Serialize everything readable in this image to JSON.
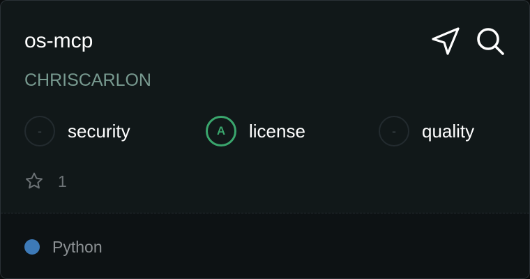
{
  "repo": {
    "name": "os-mcp",
    "owner": "CHRISCARLON"
  },
  "actions": {
    "send_icon": "send-icon",
    "search_icon": "search-icon"
  },
  "scores": [
    {
      "badge": "-",
      "label": "security"
    },
    {
      "badge": "A",
      "label": "license"
    },
    {
      "badge": "-",
      "label": "quality"
    }
  ],
  "stars": {
    "count": "1",
    "icon": "star-icon"
  },
  "language": {
    "name": "Python",
    "color": "#3d7ab8"
  },
  "colors": {
    "background": "#111819",
    "owner": "#789a90",
    "license_good": "#3aa66d"
  }
}
